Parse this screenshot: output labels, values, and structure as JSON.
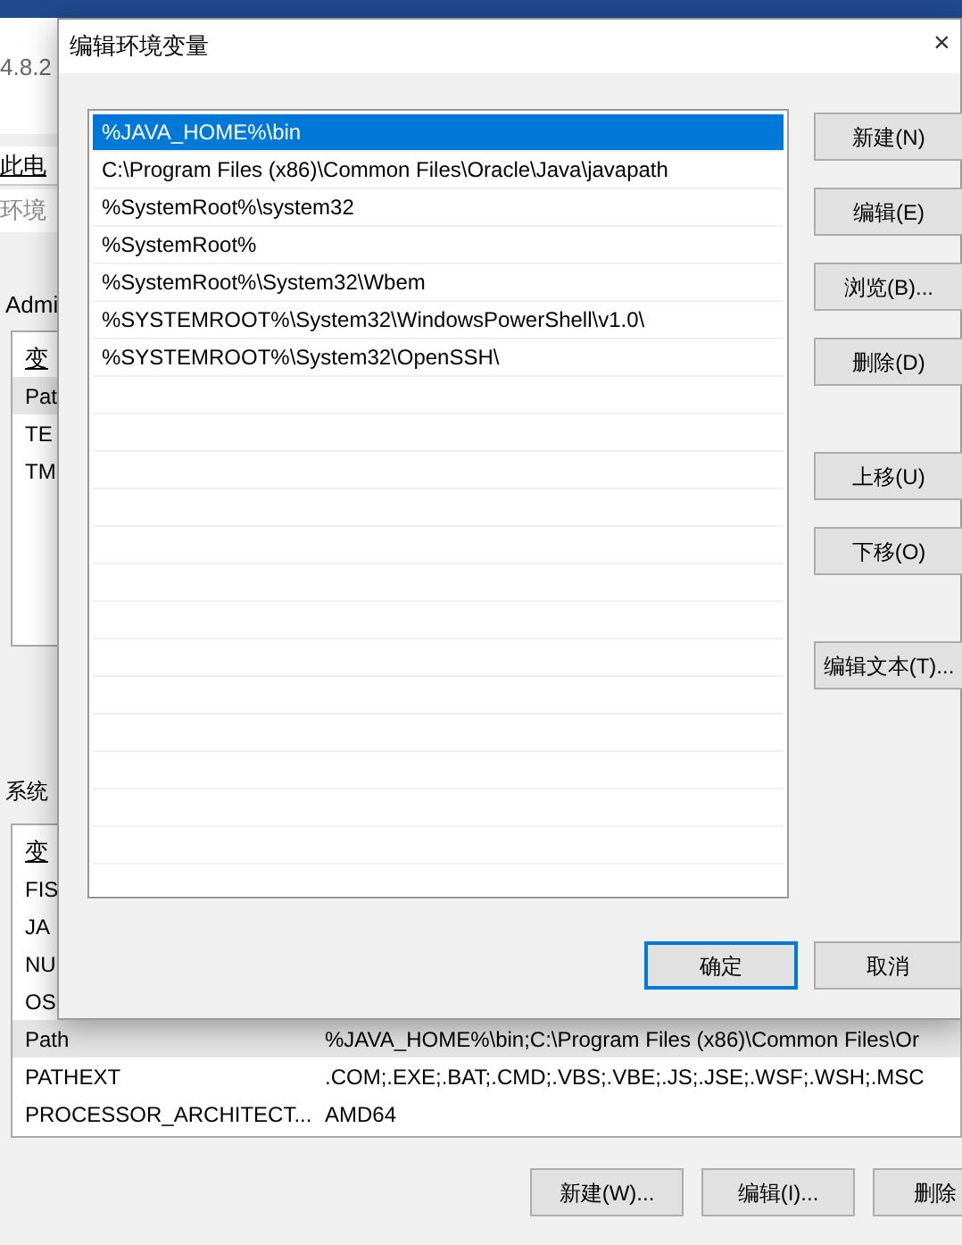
{
  "background_window": {
    "version_text": "4.8.2",
    "breadcrumb": "此电",
    "search_field": "环境",
    "user_section_label": "Admi",
    "user_variables": {
      "header": "变",
      "rows": [
        {
          "name": "Pat",
          "selected": true
        },
        {
          "name": "TE",
          "selected": false
        },
        {
          "name": "TM",
          "selected": false
        }
      ]
    },
    "system_section_label": "系统",
    "system_variables": {
      "header": "变",
      "rows": [
        {
          "name": "FIS",
          "selected": false
        },
        {
          "name": "JA",
          "selected": false
        },
        {
          "name": "NU",
          "selected": false
        },
        {
          "name": "OS",
          "selected": false
        },
        {
          "name": "Path",
          "value": "%JAVA_HOME%\\bin;C:\\Program Files (x86)\\Common Files\\Or",
          "selected": true
        },
        {
          "name": "PATHEXT",
          "value": ".COM;.EXE;.BAT;.CMD;.VBS;.VBE;.JS;.JSE;.WSF;.WSH;.MSC",
          "selected": false
        },
        {
          "name": "PROCESSOR_ARCHITECT...",
          "value": "AMD64",
          "selected": false
        }
      ]
    },
    "buttons": [
      "新建(W)...",
      "编辑(I)...",
      "删除"
    ]
  },
  "dialog": {
    "title": "编辑环境变量",
    "close": "×",
    "paths": [
      {
        "text": "%JAVA_HOME%\\bin",
        "selected": true
      },
      {
        "text": "C:\\Program Files (x86)\\Common Files\\Oracle\\Java\\javapath",
        "selected": false
      },
      {
        "text": "%SystemRoot%\\system32",
        "selected": false
      },
      {
        "text": "%SystemRoot%",
        "selected": false
      },
      {
        "text": "%SystemRoot%\\System32\\Wbem",
        "selected": false
      },
      {
        "text": "%SYSTEMROOT%\\System32\\WindowsPowerShell\\v1.0\\",
        "selected": false
      },
      {
        "text": "%SYSTEMROOT%\\System32\\OpenSSH\\",
        "selected": false
      }
    ],
    "side_button_groups": [
      [
        "新建(N)",
        "编辑(E)",
        "浏览(B)...",
        "删除(D)"
      ],
      [
        "上移(U)",
        "下移(O)"
      ],
      [
        "编辑文本(T)..."
      ]
    ],
    "ok": "确定",
    "cancel": "取消"
  }
}
